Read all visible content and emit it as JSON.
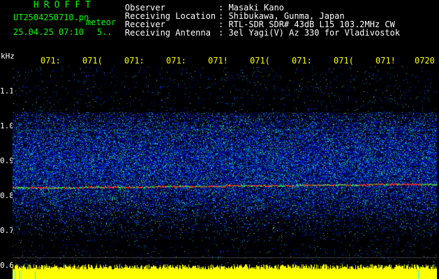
{
  "header": {
    "app_title": "HROFFT",
    "file_name": "UT2504250710.pn",
    "meteor_label": "meteor",
    "date_time": "25.04.25 07:10",
    "count": "5..",
    "meta": [
      {
        "label": "Observer",
        "value": ": Masaki Kano"
      },
      {
        "label": "Receiving Location",
        "value": ": Shibukawa, Gunma, Japan"
      },
      {
        "label": "Receiver",
        "value": ": RTL-SDR SDR# 43dB L15 103.2MHz CW"
      },
      {
        "label": "Receiving Antenna",
        "value": ": 3el Yagi(V) Az 330 for Vladivostok"
      }
    ]
  },
  "axis": {
    "unit": "kHz",
    "y_ticks": [
      "1.1",
      "1.0",
      "0.9",
      "0.8",
      "0.7",
      "0.6"
    ],
    "x_ticks": [
      "071:",
      "071(",
      "071:",
      "071:",
      "071!",
      "071(",
      "071:",
      "071(",
      "071!",
      "0720"
    ]
  },
  "colors": {
    "background": "#000000",
    "header_title": "#00ff00",
    "header_text": "#ffffff",
    "tick_text": "#ffff00",
    "noise": "#ffff00",
    "signal": "#ff2020"
  }
}
